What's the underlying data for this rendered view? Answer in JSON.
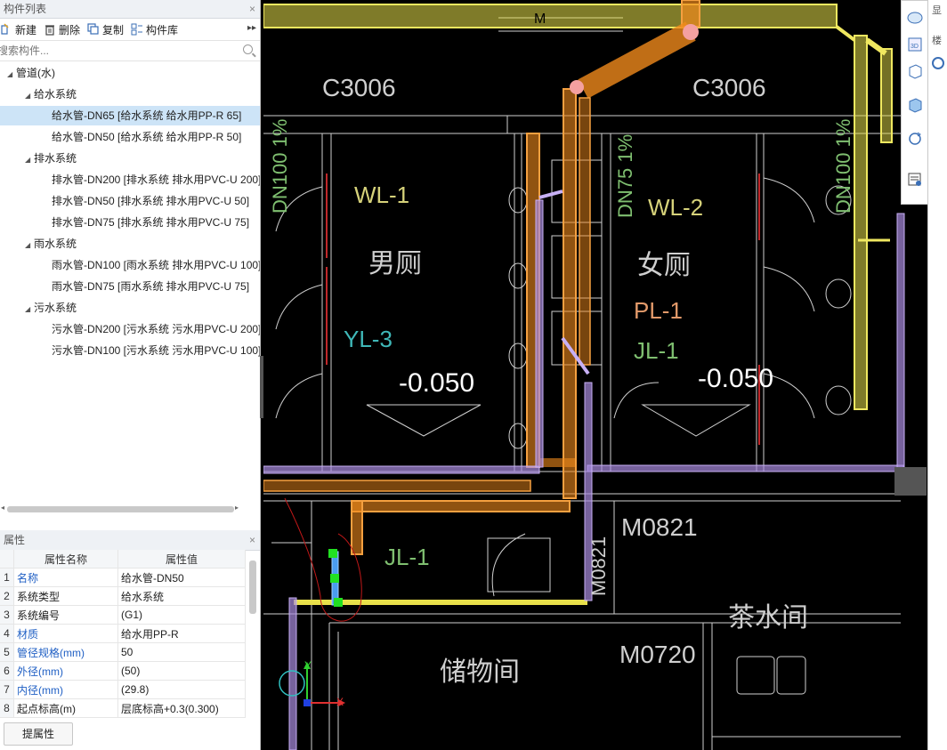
{
  "component_panel": {
    "title": "构件列表",
    "close": "×",
    "toolbar": {
      "new": "新建",
      "delete": "删除",
      "copy": "复制",
      "library": "构件库",
      "more": "▸▸"
    },
    "search_placeholder": "搜索构件...",
    "tree": {
      "root": "管道(水)",
      "groups": [
        {
          "label": "给水系统",
          "items": [
            "给水管-DN65 [给水系统 给水用PP-R 65]",
            "给水管-DN50 [给水系统 给水用PP-R 50]"
          ]
        },
        {
          "label": "排水系统",
          "items": [
            "排水管-DN200 [排水系统 排水用PVC-U 200]",
            "排水管-DN50 [排水系统 排水用PVC-U 50]",
            "排水管-DN75 [排水系统 排水用PVC-U 75]"
          ]
        },
        {
          "label": "雨水系统",
          "items": [
            "雨水管-DN100 [雨水系统 排水用PVC-U 100]",
            "雨水管-DN75 [雨水系统 排水用PVC-U 75]"
          ]
        },
        {
          "label": "污水系统",
          "items": [
            "污水管-DN200 [污水系统 污水用PVC-U 200]",
            "污水管-DN100 [污水系统 污水用PVC-U 100]"
          ]
        }
      ],
      "selected": "给水管-DN65 [给水系统 给水用PP-R 65]"
    }
  },
  "properties_panel": {
    "title": "属性",
    "close": "×",
    "headers": {
      "name": "属性名称",
      "value": "属性值"
    },
    "rows": [
      {
        "num": "1",
        "name": "名称",
        "value": "给水管-DN50",
        "blue": true
      },
      {
        "num": "2",
        "name": "系统类型",
        "value": "给水系统",
        "blue": false
      },
      {
        "num": "3",
        "name": "系统编号",
        "value": "(G1)",
        "blue": false
      },
      {
        "num": "4",
        "name": "材质",
        "value": "给水用PP-R",
        "blue": true
      },
      {
        "num": "5",
        "name": "管径规格(mm)",
        "value": "50",
        "blue": true
      },
      {
        "num": "6",
        "name": "外径(mm)",
        "value": "(50)",
        "blue": true
      },
      {
        "num": "7",
        "name": "内径(mm)",
        "value": "(29.8)",
        "blue": true
      },
      {
        "num": "8",
        "name": "起点标高(m)",
        "value": "层底标高+0.3(0.300)",
        "blue": false
      }
    ],
    "extract_button": "提属性"
  },
  "cad": {
    "labels": {
      "c3006_left": "C3006",
      "c3006_right": "C3006",
      "wl1": "WL-1",
      "wl2": "WL-2",
      "yl3": "YL-3",
      "pl1": "PL-1",
      "jl1_top": "JL-1",
      "jl1_bottom": "JL-1",
      "elev_left": "-0.050",
      "elev_right": "-0.050",
      "mens_room": "男厕",
      "womens_room": "女厕",
      "m0821": "M0821",
      "m0821_v": "M0821",
      "m0720": "M0720",
      "storage": "储物间",
      "tea_room": "茶水间",
      "dn_slope_left": "DN100 1%",
      "dn_slope_mid": "DN75 1%",
      "dn_slope_right": "DN100 1%",
      "axis_x": "X",
      "axis_y": "Y",
      "m_mark": "M"
    },
    "colors": {
      "water_yellow": "#e8e04a",
      "drain_orange": "#f08a1c",
      "pipe_purple": "#a98be0",
      "wall_white": "#d8d8d8",
      "label_yellow": "#d6d27a",
      "label_green": "#7fbf70",
      "label_salmon": "#e39a6a",
      "label_cyan": "#3fb8b8"
    }
  },
  "right_panel": {
    "label_top": "显",
    "label_2": "楼"
  }
}
